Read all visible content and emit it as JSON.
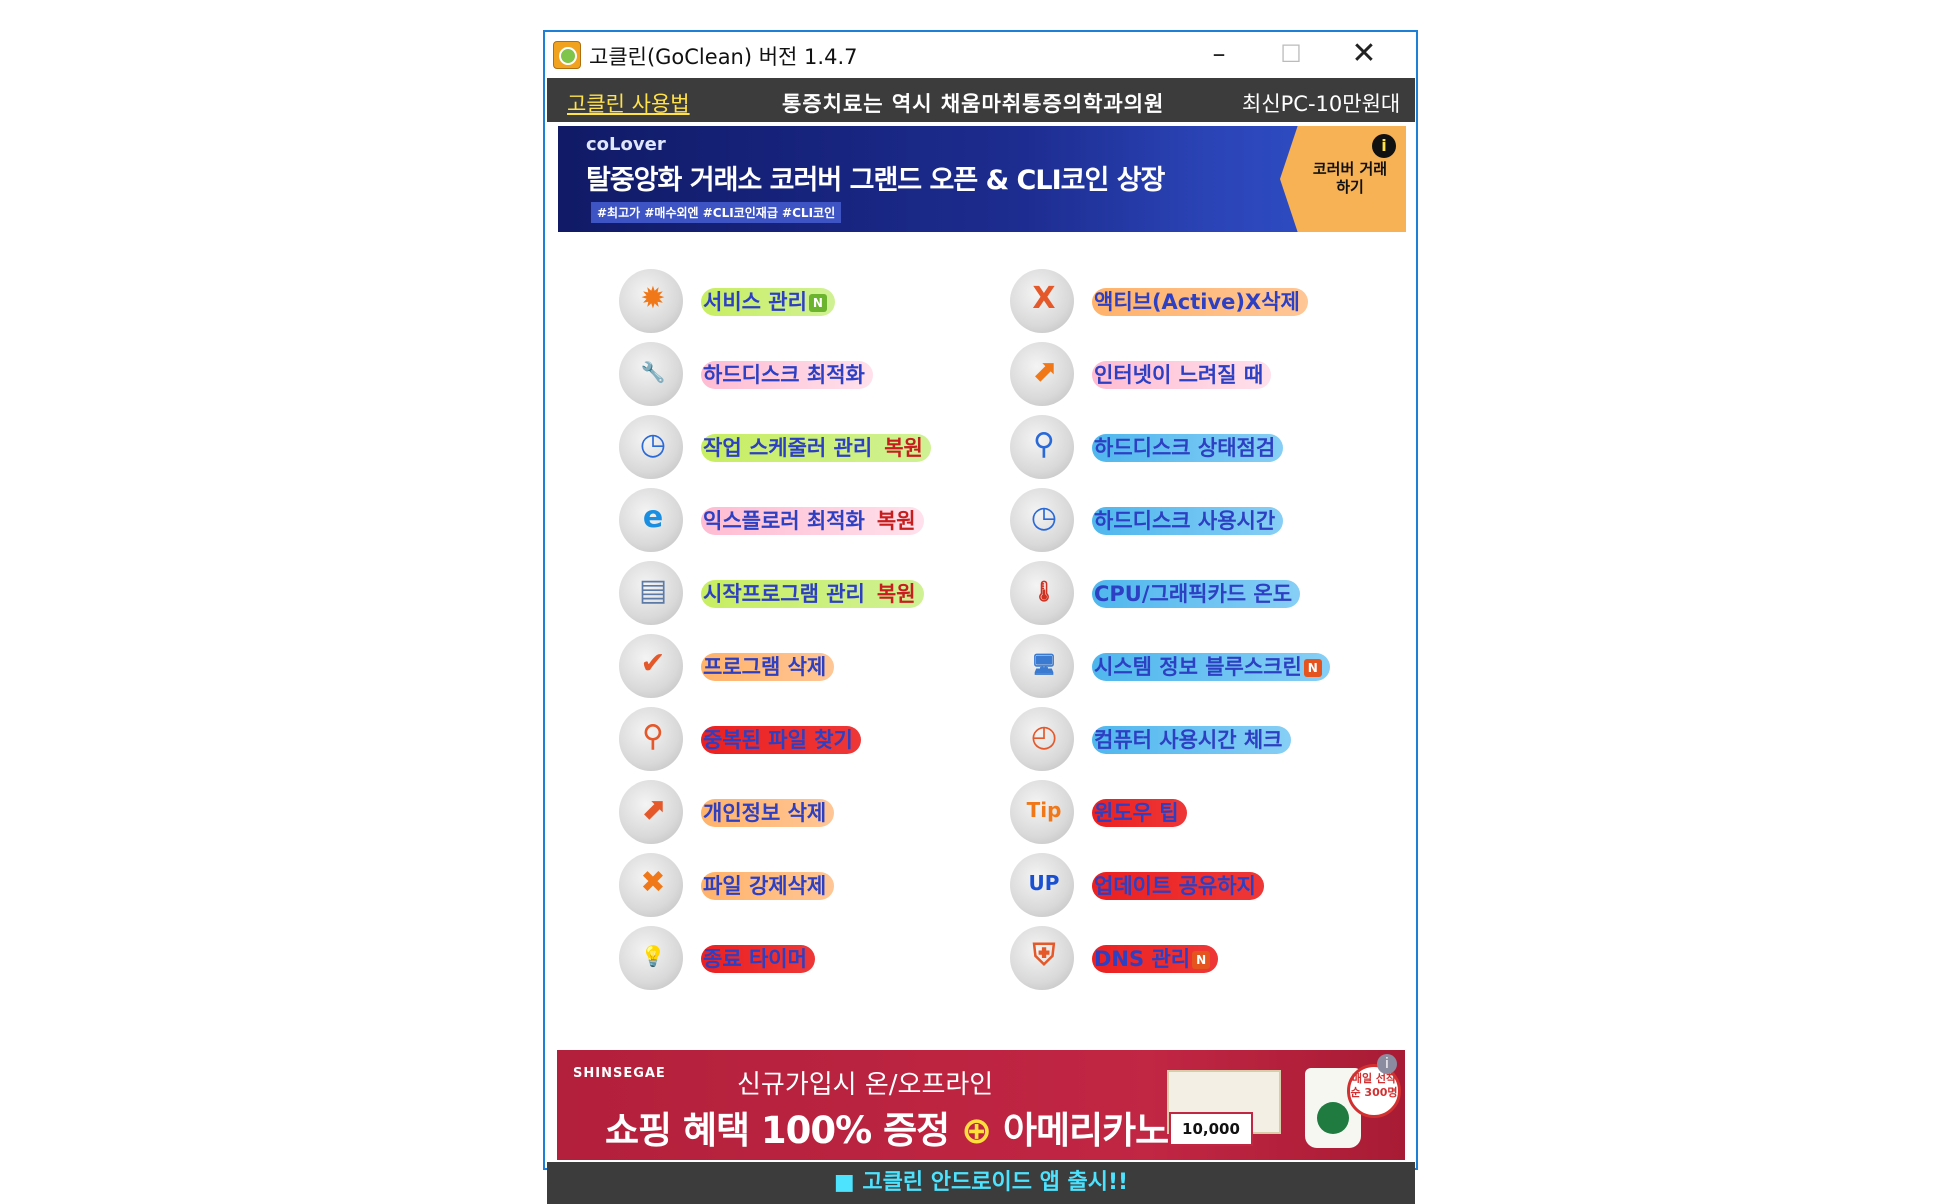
{
  "window": {
    "title": "고클린(GoClean) 버전 1.4.7"
  },
  "menubar": {
    "howto": "고클린 사용법",
    "ad1": "통증치료는 역시 채움마취통증의학과의원",
    "ad2": "최신PC-10만원대"
  },
  "banner_top": {
    "brand": "coLover",
    "headline": "탈중앙화 거래소 코러버 그랜드 오픈 & CLI코인 상장",
    "tags": "#최고가 #매수외엔 #CLI코인재급 #CLI코인",
    "cta": "코러버 거래하기",
    "info": "i"
  },
  "left_items": [
    {
      "label": "서비스 관리",
      "badge": "N",
      "extra": "",
      "icon": "gear-icon",
      "glyph": "✹",
      "glyph_color": "#f07818",
      "hl": "hl-green"
    },
    {
      "label": "하드디스크 최적화",
      "badge": "",
      "extra": "",
      "icon": "wrench-disk-icon",
      "glyph": "🔧",
      "glyph_color": "#7a7a7a",
      "hl": "hl-pink"
    },
    {
      "label": "작업 스케줄러 관리",
      "badge": "",
      "extra": "복원",
      "icon": "scheduler-clock-icon",
      "glyph": "◷",
      "glyph_color": "#2a6ad8",
      "hl": "hl-green"
    },
    {
      "label": "익스플로러 최적화",
      "badge": "",
      "extra": "복원",
      "icon": "internet-explorer-icon",
      "glyph": "e",
      "glyph_color": "#1a8ee0",
      "hl": "hl-pink"
    },
    {
      "label": "시작프로그램 관리",
      "badge": "",
      "extra": "복원",
      "icon": "document-icon",
      "glyph": "▤",
      "glyph_color": "#5c7aa8",
      "hl": "hl-green"
    },
    {
      "label": "프로그램 삭제",
      "badge": "",
      "extra": "",
      "icon": "program-check-icon",
      "glyph": "✔",
      "glyph_color": "#e4582a",
      "hl": "hl-orange"
    },
    {
      "label": "중복된 파일 찾기",
      "badge": "",
      "extra": "",
      "icon": "magnifier-icon",
      "glyph": "⚲",
      "glyph_color": "#e4582a",
      "hl": "hl-red"
    },
    {
      "label": "개인정보 삭제",
      "badge": "",
      "extra": "",
      "icon": "privacy-arrow-icon",
      "glyph": "⬈",
      "glyph_color": "#e4582a",
      "hl": "hl-orange"
    },
    {
      "label": "파일 강제삭제",
      "badge": "",
      "extra": "",
      "icon": "delete-x-icon",
      "glyph": "✖",
      "glyph_color": "#f07818",
      "hl": "hl-orange"
    },
    {
      "label": "종료 타이머",
      "badge": "",
      "extra": "",
      "icon": "sleep-bulb-icon",
      "glyph": "💡",
      "glyph_color": "#d0a010",
      "hl": "hl-red"
    }
  ],
  "right_items": [
    {
      "label": "액티브(Active)X삭제",
      "badge": "",
      "extra": "",
      "icon": "activex-icon",
      "glyph": "X",
      "glyph_color": "#e4582a",
      "hl": "hl-orange"
    },
    {
      "label": "인터넷이 느려질 때",
      "badge": "",
      "extra": "",
      "icon": "internet-arrow-icon",
      "glyph": "⬈",
      "glyph_color": "#f07818",
      "hl": "hl-pink"
    },
    {
      "label": "하드디스크 상태점검",
      "badge": "",
      "extra": "",
      "icon": "disk-search-icon",
      "glyph": "⚲",
      "glyph_color": "#2a6ad8",
      "hl": "hl-blue"
    },
    {
      "label": "하드디스크 사용시간",
      "badge": "",
      "extra": "",
      "icon": "disk-clock-icon",
      "glyph": "◷",
      "glyph_color": "#2a6ad8",
      "hl": "hl-blue"
    },
    {
      "label": "CPU/그래픽카드 온도",
      "badge": "",
      "extra": "",
      "icon": "thermometer-icon",
      "glyph": "🌡",
      "glyph_color": "#d03020",
      "hl": "hl-blue"
    },
    {
      "label": "시스템 정보 블루스크린",
      "badge": "N",
      "extra": "",
      "icon": "computer-icon",
      "glyph": "🖥",
      "glyph_color": "#3a7ad0",
      "hl": "hl-blue"
    },
    {
      "label": "컴퓨터 사용시간 체크",
      "badge": "",
      "extra": "",
      "icon": "clock-icon",
      "glyph": "◴",
      "glyph_color": "#e4582a",
      "hl": "hl-blue"
    },
    {
      "label": "윈도우 팁",
      "badge": "",
      "extra": "",
      "icon": "tip-icon",
      "glyph": "Tip",
      "glyph_color": "#f07818",
      "hl": "hl-red"
    },
    {
      "label": "업데이트 공유하지",
      "badge": "",
      "extra": "",
      "icon": "update-up-icon",
      "glyph": "UP",
      "glyph_color": "#1a4fd0",
      "hl": "hl-red"
    },
    {
      "label": "DNS 관리",
      "badge": "N",
      "extra": "",
      "icon": "shield-icon",
      "glyph": "⛨",
      "glyph_color": "#e4582a",
      "hl": "hl-red"
    }
  ],
  "banner_bottom": {
    "brand": "SHINSEGAE",
    "line1": "신규가입시 온/오프라인",
    "line2a": "쇼핑 혜택 100% 증정",
    "line2plus": "⊕",
    "line2b": "아메리카노",
    "coupon": "10,000",
    "stamp": "매일 선착순 300명",
    "info": "i"
  },
  "footer": {
    "text": "■ 고클린 안드로이드 앱 출시!!"
  }
}
